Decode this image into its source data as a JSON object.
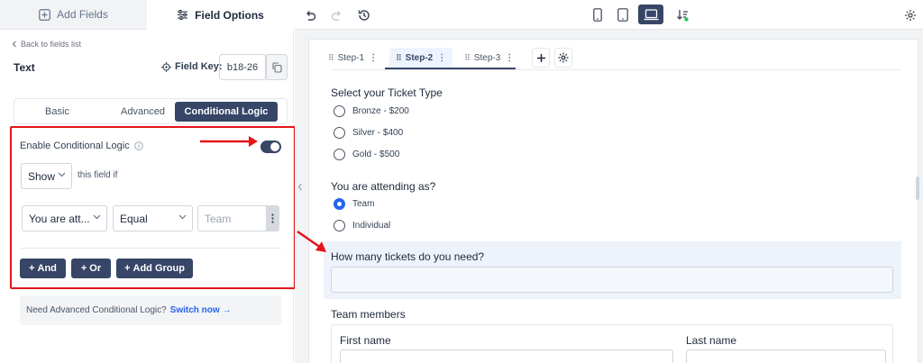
{
  "left_panel": {
    "tabs": {
      "add_fields": "Add Fields",
      "field_options": "Field Options"
    },
    "back_link": "Back to fields list",
    "field_type": "Text",
    "field_key_label": "Field Key:",
    "field_key_value": "b18-26",
    "subtabs": {
      "basic": "Basic",
      "advanced": "Advanced",
      "conditional": "Conditional Logic"
    },
    "conditional": {
      "enable_label": "Enable Conditional Logic",
      "enabled": true,
      "action": "Show",
      "action_suffix": "this field if",
      "rule_field": "You are att...",
      "rule_operator": "Equal",
      "rule_value_placeholder": "Team",
      "buttons": {
        "and": "And",
        "or": "Or",
        "add_group": "Add Group"
      }
    },
    "advanced_note": {
      "text": "Need Advanced Conditional Logic?",
      "link": "Switch now →"
    }
  },
  "toolbar": {
    "active_device": "desktop"
  },
  "form": {
    "steps": [
      "Step-1",
      "Step-2",
      "Step-3"
    ],
    "active_step": "Step-2",
    "ticket_question": "Select your Ticket Type",
    "ticket_options": [
      "Bronze - $200",
      "Silver - $400",
      "Gold - $500"
    ],
    "attending_question": "You are attending as?",
    "attending_options": [
      "Team",
      "Individual"
    ],
    "attending_selected": "Team",
    "tickets_question": "How many tickets do you need?",
    "team_members_label": "Team members",
    "first_name_label": "First name",
    "last_name_label": "Last name"
  },
  "colors": {
    "accent": "#374667",
    "highlight": "#e3151a",
    "radio_selected": "#2563eb"
  }
}
